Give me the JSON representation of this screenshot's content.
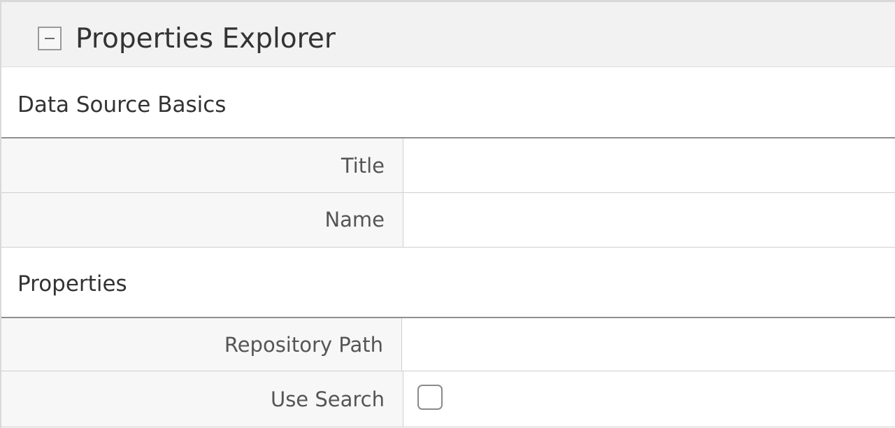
{
  "panel": {
    "title": "Properties Explorer",
    "collapse_icon": "minus-square-icon"
  },
  "sections": [
    {
      "title": "Data Source Basics",
      "fields": [
        {
          "label": "Title",
          "value": ""
        },
        {
          "label": "Name",
          "value": ""
        }
      ]
    },
    {
      "title": "Properties",
      "fields": [
        {
          "label": "Repository Path",
          "value": ""
        },
        {
          "label": "Use Search",
          "type": "checkbox",
          "checked": false
        }
      ]
    }
  ]
}
